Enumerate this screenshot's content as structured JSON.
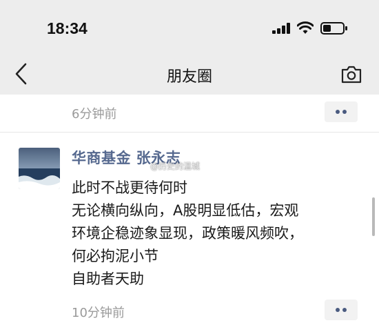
{
  "status_bar": {
    "time": "18:34"
  },
  "nav": {
    "title": "朋友圈"
  },
  "prev_post": {
    "timestamp": "6分钟前"
  },
  "post": {
    "author": "华商基金 张永志",
    "watermark": "@历史的温城",
    "lines": [
      "此时不战更待何时",
      "无论横向纵向，A股明显低估，宏观",
      "环境企稳迹象显现，政策暖风频吹，",
      "何必拘泥小节",
      "自助者天助"
    ],
    "timestamp": "10分钟前"
  },
  "icons": {
    "back": "chevron-left-icon",
    "camera": "camera-icon",
    "signal": "cellular-signal-icon",
    "wifi": "wifi-icon",
    "battery": "battery-icon",
    "more": "more-dots-icon"
  },
  "colors": {
    "author_link": "#56698f",
    "timestamp": "#9a9a9a",
    "header_bg": "#ededed",
    "more_dots": "#4a5b80"
  }
}
